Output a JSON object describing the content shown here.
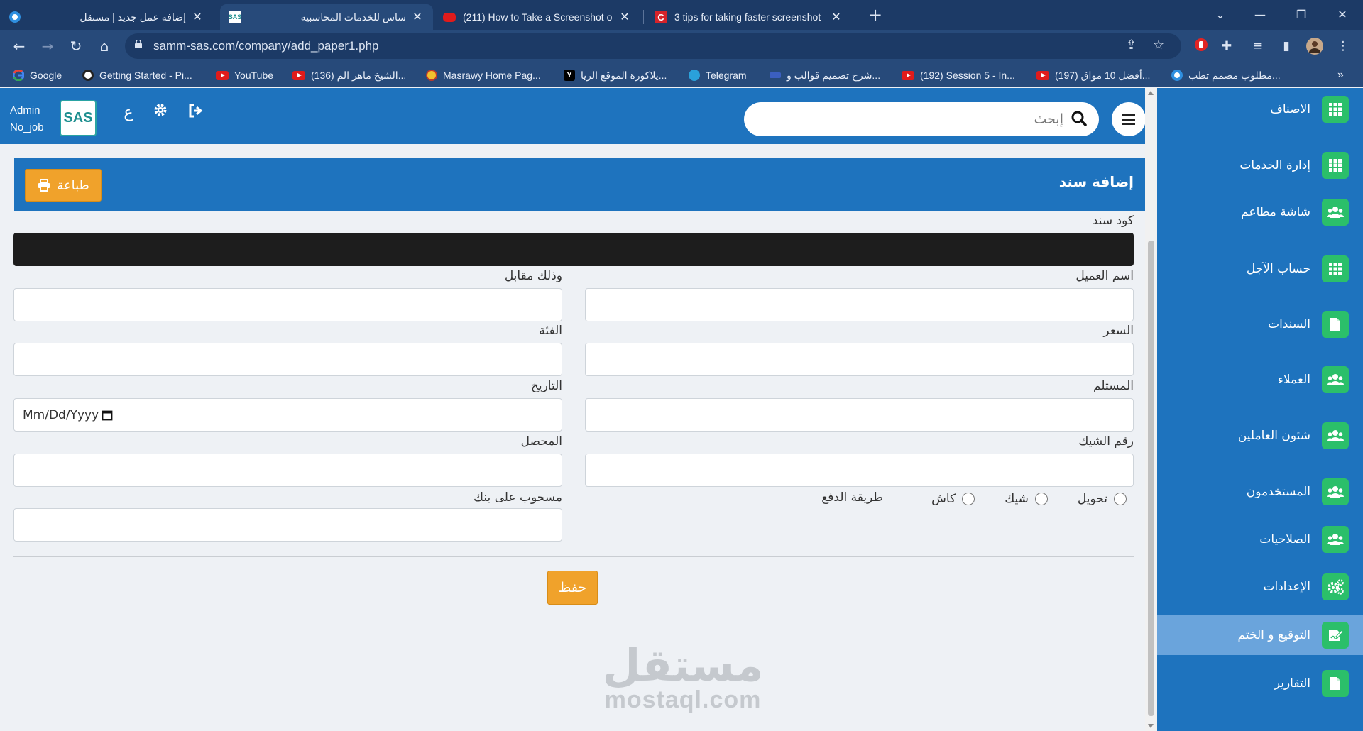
{
  "browser": {
    "tabs": [
      {
        "title": "إضافة عمل جديد | مستقل",
        "favicon_color": "#1e73be"
      },
      {
        "title": "ساس للخدمات المحاسبية",
        "favicon_label": "SAS"
      },
      {
        "title": "(211) How to Take a Screenshot o",
        "favicon_color": "#e01b1b"
      },
      {
        "title": "3 tips for taking faster screenshot",
        "favicon_color": "#d6232a"
      }
    ],
    "new_tab_symbol": "+",
    "url": "samm-sas.com/company/add_paper1.php",
    "bookmarks": [
      {
        "label": "Google",
        "kind": "google"
      },
      {
        "label": "Getting Started - Pi...",
        "kind": "generic"
      },
      {
        "label": "YouTube",
        "kind": "youtube"
      },
      {
        "label": "(136) الشيخ ماهر الم...",
        "kind": "youtube"
      },
      {
        "label": "Masrawy Home Pag...",
        "kind": "generic"
      },
      {
        "label": "يلاكورة الموقع الريا...",
        "kind": "y"
      },
      {
        "label": "Telegram",
        "kind": "telegram"
      },
      {
        "label": "شرح تصميم قوالب و...",
        "kind": "generic"
      },
      {
        "label": "(192) Session 5 - In...",
        "kind": "youtube"
      },
      {
        "label": "(197) أفضل 10 مواق...",
        "kind": "youtube"
      },
      {
        "label": "مطلوب مصمم تطب...",
        "kind": "mostaql"
      }
    ],
    "more_bookmarks": "»"
  },
  "header": {
    "search_placeholder": "إبحث",
    "lang_toggle": "ع",
    "logo_text": "SAS",
    "user_name": "Admin",
    "user_job": "No_job"
  },
  "sidebar": {
    "items": [
      {
        "label": "الاصناف",
        "icon": "grid-icon"
      },
      {
        "label": "إدارة الخدمات",
        "icon": "grid-icon"
      },
      {
        "label": "شاشة مطاعم",
        "icon": "users-icon"
      },
      {
        "label": "حساب الآجل",
        "icon": "grid-icon"
      },
      {
        "label": "السندات",
        "icon": "file-icon"
      },
      {
        "label": "العملاء",
        "icon": "users-icon"
      },
      {
        "label": "شئون العاملين",
        "icon": "users-icon"
      },
      {
        "label": "المستخدمون",
        "icon": "users-icon"
      },
      {
        "label": "الصلاحيات",
        "icon": "users-icon"
      },
      {
        "label": "الإعدادات",
        "icon": "cogs-icon"
      },
      {
        "label": "التوقيع و الختم",
        "icon": "signature-icon",
        "active": true
      },
      {
        "label": "التقارير",
        "icon": "file-icon"
      }
    ]
  },
  "page": {
    "title": "إضافة سند",
    "print_label": "طباعة"
  },
  "form": {
    "code_label": "كود سند",
    "customer_name_label": "اسم العميل",
    "in_return_label": "وذلك مقابل",
    "price_label": "السعر",
    "category_label": "الفئة",
    "receiver_label": "المستلم",
    "date_label": "التاريخ",
    "date_placeholder": "Mm/Dd/Yyyy",
    "check_number_label": "رقم الشيك",
    "collector_label": "المحصل",
    "payment_method_label": "طريقة الدفع",
    "payment_options": [
      "تحويل",
      "شيك",
      "كاش"
    ],
    "drawn_on_bank_label": "مسحوب على بنك",
    "save_label": "حفظ"
  },
  "watermark": {
    "arabic": "مستقل",
    "latin": "mostaql.com"
  },
  "colors": {
    "primary_blue": "#1e73be",
    "sidebar_active": "#6aa4dc",
    "icon_green": "#2bbf6a",
    "button_orange": "#f0a22b",
    "chrome_dark": "#1c3a66",
    "chrome_mid": "#274a7a"
  }
}
